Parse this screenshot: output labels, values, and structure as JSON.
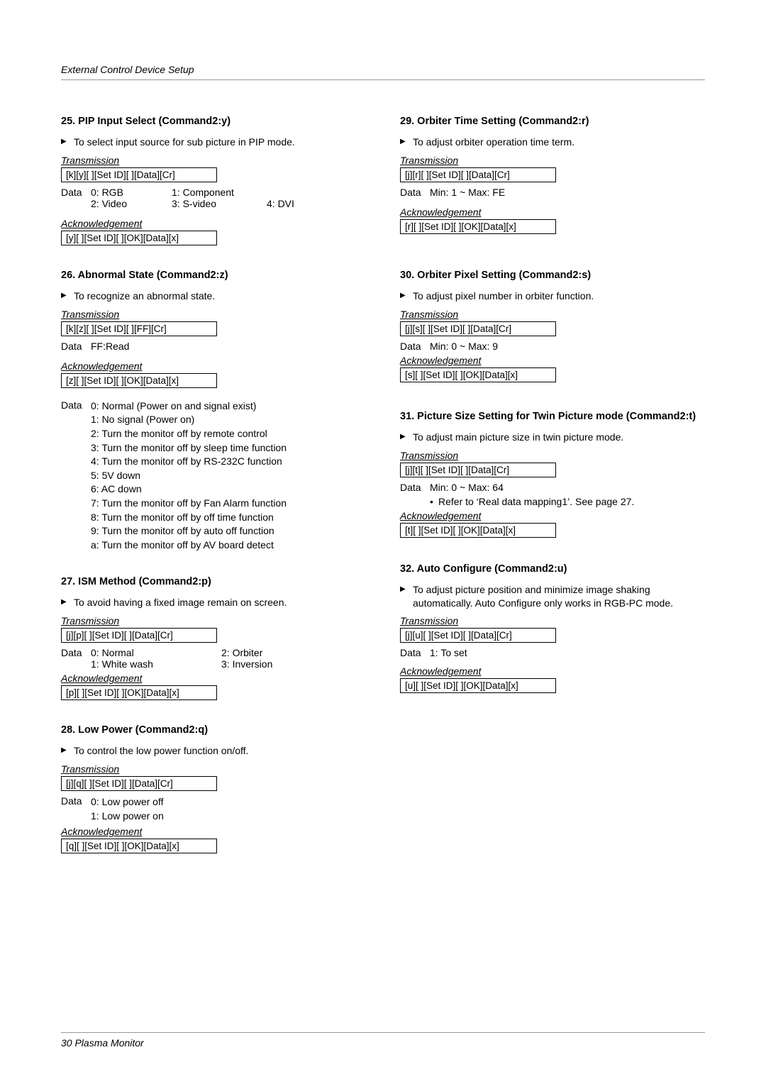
{
  "header": {
    "title": "External Control Device Setup"
  },
  "footer": {
    "text": "30   Plasma Monitor"
  },
  "left": {
    "c25": {
      "title": "25. PIP Input Select (Command2:y)",
      "desc": "To select input source for sub picture in PIP mode.",
      "trans_hdr": "Transmission",
      "trans_code": "[k][y][  ][Set ID][  ][Data][Cr]",
      "data_label": "Data",
      "d0": "0: RGB",
      "d1": "1: Component",
      "d2": "2: Video",
      "d3": "3: S-video",
      "d4": "4: DVI",
      "ack_hdr": "Acknowledgement",
      "ack_code": "[y][  ][Set ID][  ][OK][Data][x]"
    },
    "c26": {
      "title": "26. Abnormal State (Command2:z)",
      "desc": "To recognize an abnormal state.",
      "trans_hdr": "Transmission",
      "trans_code": "[k][z][  ][Set ID][  ][FF][Cr]",
      "data_label": "Data",
      "data_val": "FF:Read",
      "ack_hdr": "Acknowledgement",
      "ack_code": "[z][  ][Set ID][  ][OK][Data][x]",
      "data_label2": "Data",
      "v0": "0: Normal (Power on and signal exist)",
      "v1": "1: No signal (Power on)",
      "v2": "2: Turn the monitor off by remote control",
      "v3": "3: Turn the monitor off by sleep time function",
      "v4": "4: Turn the monitor off by RS-232C function",
      "v5": "5: 5V down",
      "v6": "6: AC down",
      "v7": "7: Turn the monitor off by Fan Alarm function",
      "v8": "8: Turn the monitor off by off time function",
      "v9": "9: Turn the monitor off by auto off function",
      "va": "a: Turn the monitor off by AV board detect"
    },
    "c27": {
      "title": "27. ISM Method (Command2:p)",
      "desc": "To avoid having a fixed image remain on screen.",
      "trans_hdr": "Transmission",
      "trans_code": "[j][p][  ][Set ID][  ][Data][Cr]",
      "data_label": "Data",
      "d0": "0: Normal",
      "d2": "2: Orbiter",
      "d1": "1: White wash",
      "d3": "3: Inversion",
      "ack_hdr": "Acknowledgement",
      "ack_code": "[p][  ][Set ID][  ][OK][Data][x]"
    },
    "c28": {
      "title": "28. Low Power (Command2:q)",
      "desc": "To control the low power function on/off.",
      "trans_hdr": "Transmission",
      "trans_code": "[j][q][  ][Set ID][  ][Data][Cr]",
      "data_label": "Data",
      "d0": "0: Low power off",
      "d1": "1: Low power on",
      "ack_hdr": "Acknowledgement",
      "ack_code": "[q][  ][Set ID][  ][OK][Data][x]"
    }
  },
  "right": {
    "c29": {
      "title": "29. Orbiter Time Setting (Command2:r)",
      "desc": "To adjust orbiter operation time term.",
      "trans_hdr": "Transmission",
      "trans_code": "[j][r][  ][Set ID][  ][Data][Cr]",
      "data_label": "Data",
      "data_val": "Min: 1 ~ Max: FE",
      "ack_hdr": "Acknowledgement",
      "ack_code": "[r][  ][Set ID][  ][OK][Data][x]"
    },
    "c30": {
      "title": "30. Orbiter Pixel Setting (Command2:s)",
      "desc": "To adjust pixel number in orbiter function.",
      "trans_hdr": "Transmission",
      "trans_code": "[j][s][  ][Set ID][  ][Data][Cr]",
      "data_label": "Data",
      "data_val": "Min: 0 ~ Max: 9",
      "ack_hdr": "Acknowledgement",
      "ack_code": "[s][  ][Set ID][  ][OK][Data][x]"
    },
    "c31": {
      "title": "31. Picture Size Setting for Twin Picture mode (Command2:t)",
      "desc": "To adjust main picture size in twin picture mode.",
      "trans_hdr": "Transmission",
      "trans_code": "[j][t][  ][Set ID][  ][Data][Cr]",
      "data_label": "Data",
      "data_val": "Min: 0 ~ Max: 64",
      "note": "Refer to ‘Real data mapping1’. See page 27.",
      "ack_hdr": "Acknowledgement",
      "ack_code": "[t][  ][Set ID][  ][OK][Data][x]"
    },
    "c32": {
      "title": "32. Auto Configure (Command2:u)",
      "desc": "To adjust picture position and minimize image shaking automatically. Auto Configure only works in RGB-PC mode.",
      "trans_hdr": "Transmission",
      "trans_code": "[j][u][  ][Set ID][  ][Data][Cr]",
      "data_label": "Data",
      "data_val": "1: To set",
      "ack_hdr": "Acknowledgement",
      "ack_code": "[u][  ][Set ID][  ][OK][Data][x]"
    }
  }
}
